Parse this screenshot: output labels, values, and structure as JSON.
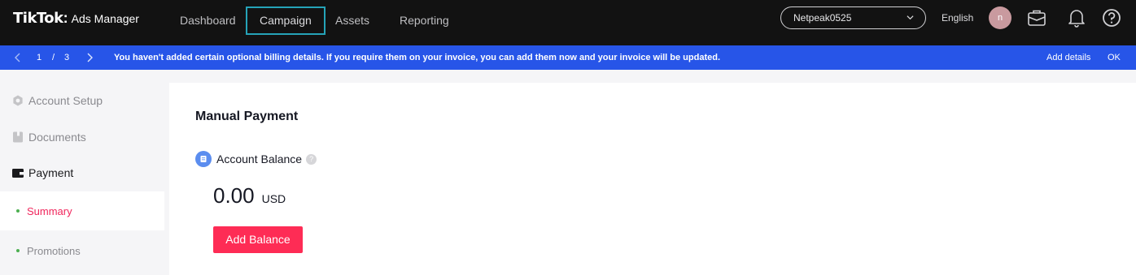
{
  "brand": {
    "name": "TikTok",
    "colon": ":",
    "product": "Ads Manager"
  },
  "nav": [
    {
      "label": "Dashboard"
    },
    {
      "label": "Campaign"
    },
    {
      "label": "Assets"
    },
    {
      "label": "Reporting"
    }
  ],
  "header": {
    "account": "Netpeak0525",
    "language": "English",
    "avatar_initial": "n",
    "icons": [
      "briefcase-icon",
      "bell-icon",
      "help-icon"
    ]
  },
  "banner": {
    "page_current": "1",
    "page_separator": "/",
    "page_total": "3",
    "message": "You haven't added certain optional billing details. If you require them on your invoice, you can add them now and your invoice will be updated.",
    "add_details": "Add details",
    "ok": "OK"
  },
  "sidebar": {
    "items": [
      {
        "label": "Account Setup",
        "icon": "gear-hex-icon"
      },
      {
        "label": "Documents",
        "icon": "document-icon"
      },
      {
        "label": "Payment",
        "icon": "wallet-icon"
      }
    ],
    "payment_sub": [
      {
        "label": "Summary"
      },
      {
        "label": "Promotions"
      }
    ]
  },
  "main": {
    "title": "Manual Payment",
    "balance_label": "Account Balance",
    "help_glyph": "?",
    "amount": "0.00",
    "currency": "USD",
    "add_balance": "Add Balance"
  },
  "colors": {
    "topbar": "#121212",
    "banner": "#2755e8",
    "accent": "#fe2c55",
    "active_nav_border": "#25a3b8",
    "sub_dot": "#4caf50"
  }
}
